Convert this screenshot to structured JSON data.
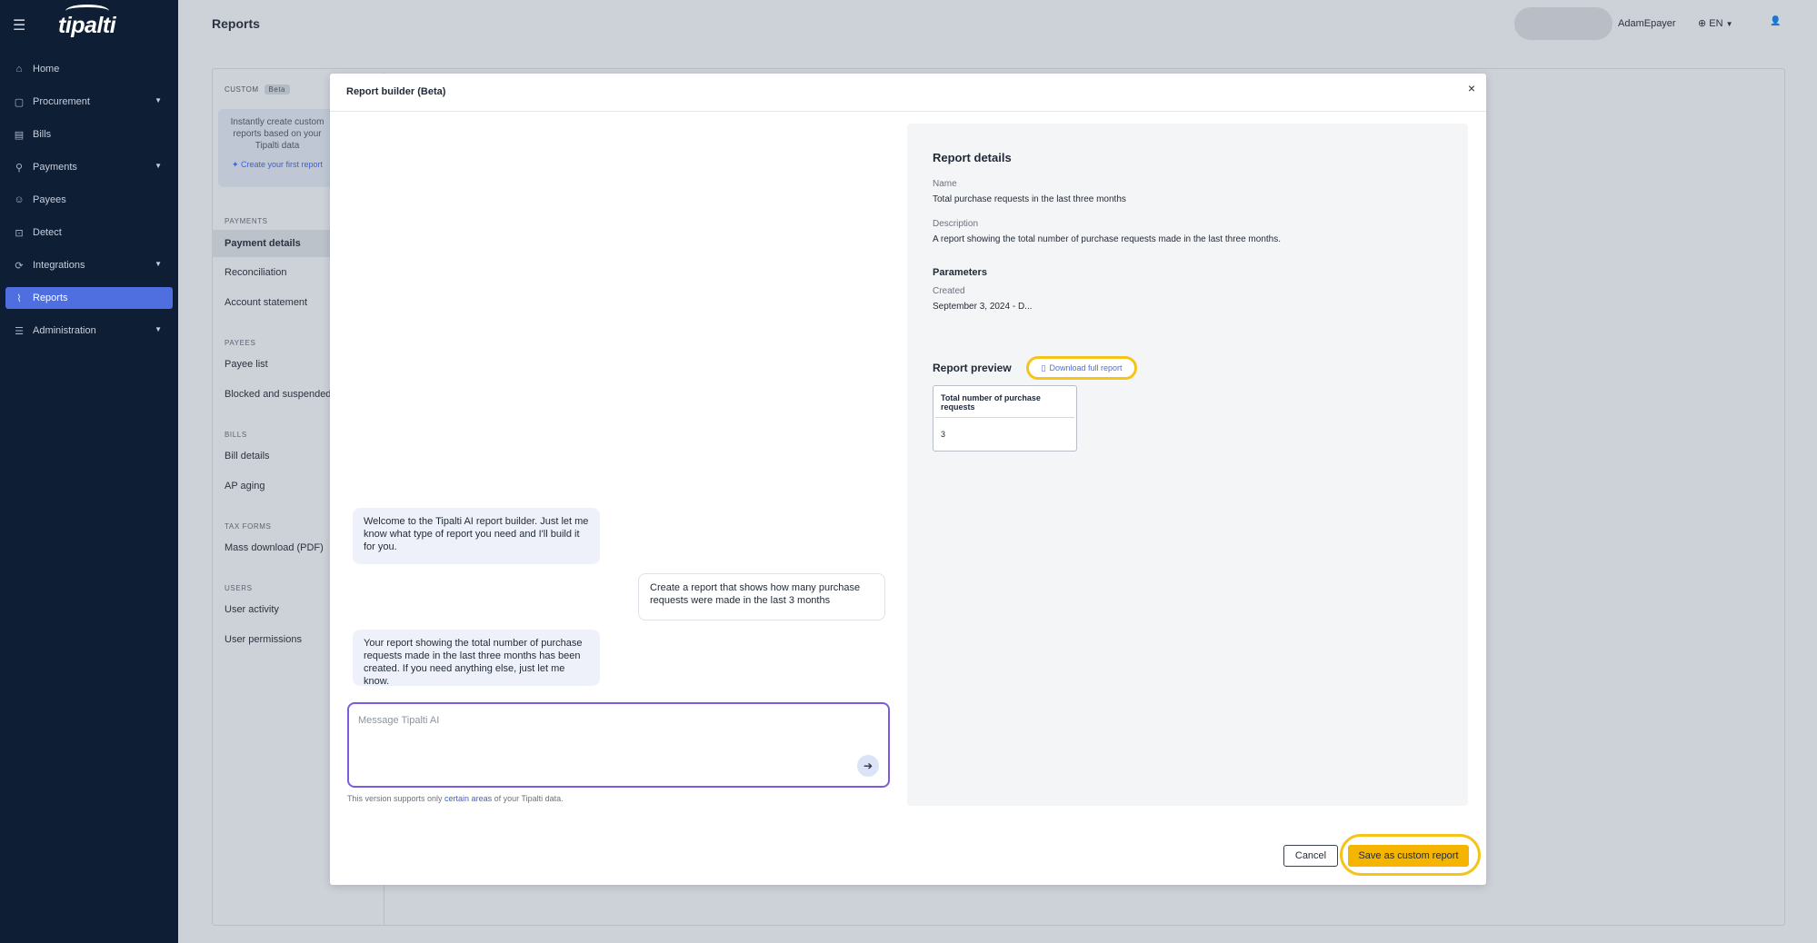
{
  "brand": {
    "logo": "tipalti"
  },
  "sidebar": {
    "items": [
      {
        "label": "Home",
        "icon": "home-icon",
        "glyph": "⌂"
      },
      {
        "label": "Procurement",
        "icon": "procurement-icon",
        "glyph": "▢",
        "caret": true
      },
      {
        "label": "Bills",
        "icon": "bills-icon",
        "glyph": "▤"
      },
      {
        "label": "Payments",
        "icon": "payments-icon",
        "glyph": "⚲",
        "caret": true
      },
      {
        "label": "Payees",
        "icon": "payees-icon",
        "glyph": "☺"
      },
      {
        "label": "Detect",
        "icon": "detect-icon",
        "glyph": "⊡"
      },
      {
        "label": "Integrations",
        "icon": "integrations-icon",
        "glyph": "⟳",
        "caret": true
      },
      {
        "label": "Reports",
        "icon": "reports-icon",
        "glyph": "⌇",
        "active": true
      },
      {
        "label": "Administration",
        "icon": "administration-icon",
        "glyph": "☰",
        "caret": true
      }
    ]
  },
  "header": {
    "title": "Reports",
    "user_name": "AdamEpayer",
    "language": "EN"
  },
  "background_page": {
    "custom_label": "CUSTOM",
    "beta_badge": "Beta",
    "promo_text": "Instantly create custom reports based on your Tipalti data",
    "promo_link": "✦ Create your first report",
    "sections": [
      {
        "title": "PAYMENTS",
        "links": [
          "Payment details",
          "Reconciliation",
          "Account statement"
        ]
      },
      {
        "title": "PAYEES",
        "links": [
          "Payee list",
          "Blocked and suspended"
        ]
      },
      {
        "title": "BILLS",
        "links": [
          "Bill details",
          "AP aging"
        ]
      },
      {
        "title": "TAX FORMS",
        "links": [
          "Mass download (PDF)"
        ]
      },
      {
        "title": "USERS",
        "links": [
          "User activity",
          "User permissions"
        ]
      }
    ]
  },
  "modal": {
    "title": "Report builder (Beta)",
    "close": "×",
    "chat": {
      "messages": [
        {
          "role": "ai",
          "text": "Welcome to the Tipalti AI report builder. Just let me know what type of report you need and I'll build it for you."
        },
        {
          "role": "user",
          "text": "Create a report that shows how many purchase requests were made in the last 3 months"
        },
        {
          "role": "ai",
          "text": "Your report showing the total number of purchase requests made in the last three months has been created. If you need anything else, just let me know."
        }
      ],
      "input_placeholder": "Message Tipalti AI",
      "note_prefix": "This version supports only ",
      "note_link": "certain areas",
      "note_suffix": " of your Tipalti data."
    },
    "details": {
      "heading": "Report details",
      "name_label": "Name",
      "name_value": "Total purchase requests in the last three months",
      "description_label": "Description",
      "description_value": "A report showing the total number of purchase requests made in the last three months.",
      "parameters_heading": "Parameters",
      "created_label": "Created",
      "created_value": "September 3, 2024 - D...",
      "preview_heading": "Report preview",
      "download_label": "Download full report",
      "preview_table": {
        "headers": [
          "Total number of purchase requests"
        ],
        "rows": [
          [
            "3"
          ]
        ]
      }
    },
    "footer": {
      "cancel_label": "Cancel",
      "save_label": "Save as custom report"
    }
  },
  "colors": {
    "sidebar_bg": "#0e1e35",
    "active_nav": "#4f6ee0",
    "highlight_ring": "#f5c418",
    "save_button": "#f5b400",
    "input_border": "#7b5ce0"
  }
}
